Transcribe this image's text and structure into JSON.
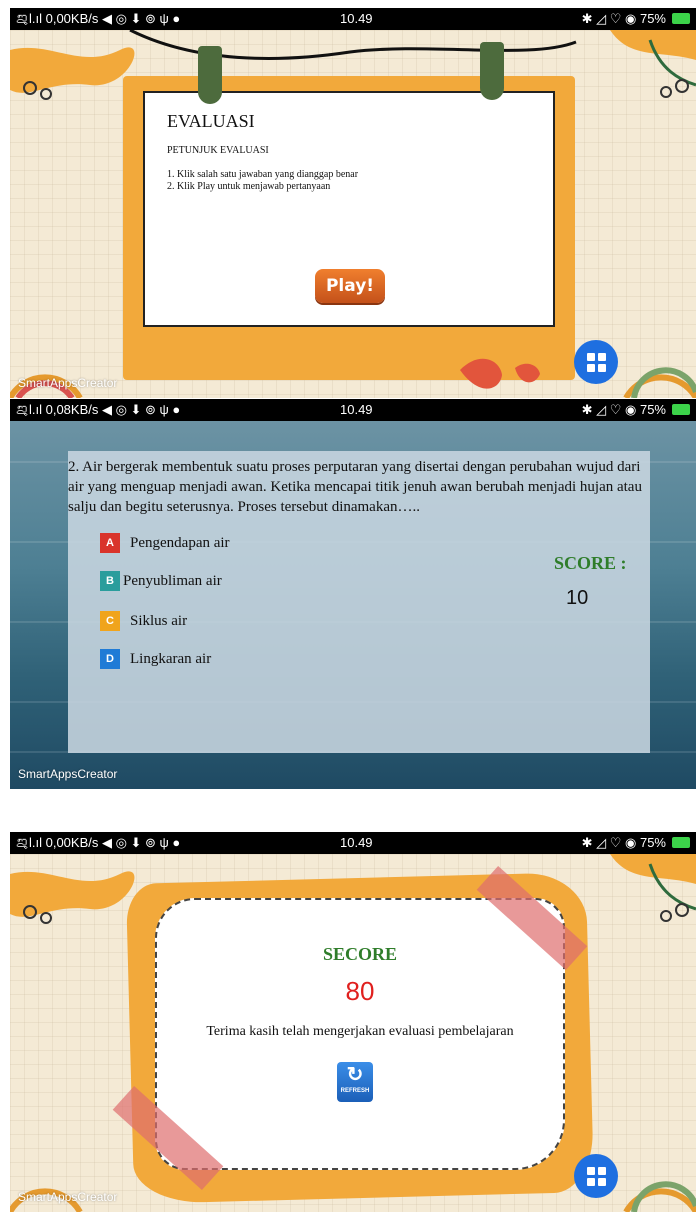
{
  "screens": [
    {
      "status": {
        "left": "ࡡl.ıl 0,00KB/s ◀ ◎ ⬇ ⊚ ψ ●",
        "time": "10.49",
        "right": "✱ ◿ ♡ ◉ 75%"
      },
      "watermark": "SmartAppsCreator",
      "title": "EVALUASI",
      "subtitle": "PETUNJUK EVALUASI",
      "steps": [
        "1. Klik salah satu jawaban yang dianggap benar",
        "2. Klik Play untuk menjawab pertanyaan"
      ],
      "play_label": "Play!"
    },
    {
      "status": {
        "left": "ࡡl.ıl 0,08KB/s ◀ ◎ ⬇ ⊚ ψ ●",
        "time": "10.49",
        "right": "✱ ◿ ♡ ◉ 75%"
      },
      "watermark": "SmartAppsCreator",
      "question": "2. Air bergerak membentuk suatu proses perputaran yang disertai dengan perubahan wujud dari air yang menguap menjadi awan. Ketika mencapai titik jenuh awan berubah menjadi hujan atau salju dan begitu seterusnya. Proses tersebut dinamakan…..",
      "options": [
        {
          "letter": "A",
          "text": "Pengendapan air",
          "color": "#d9342b"
        },
        {
          "letter": "B",
          "text": "Penyubliman air",
          "color": "#2a9d9c"
        },
        {
          "letter": "C",
          "text": "Siklus air",
          "color": "#f0a41c"
        },
        {
          "letter": "D",
          "text": "Lingkaran air",
          "color": "#1f7bd6"
        }
      ],
      "score_label": "SCORE :",
      "score_value": "10"
    },
    {
      "status": {
        "left": "ࡡl.ıl 0,00KB/s ◀ ◎ ⬇ ⊚ ψ ●",
        "time": "10.49",
        "right": "✱ ◿ ♡ ◉ 75%"
      },
      "watermark": "SmartAppsCreator",
      "score_title": "SECORE",
      "score_value": "80",
      "thanks": "Terima kasih telah mengerjakan evaluasi pembelajaran",
      "refresh_label": "REFRESH"
    }
  ]
}
